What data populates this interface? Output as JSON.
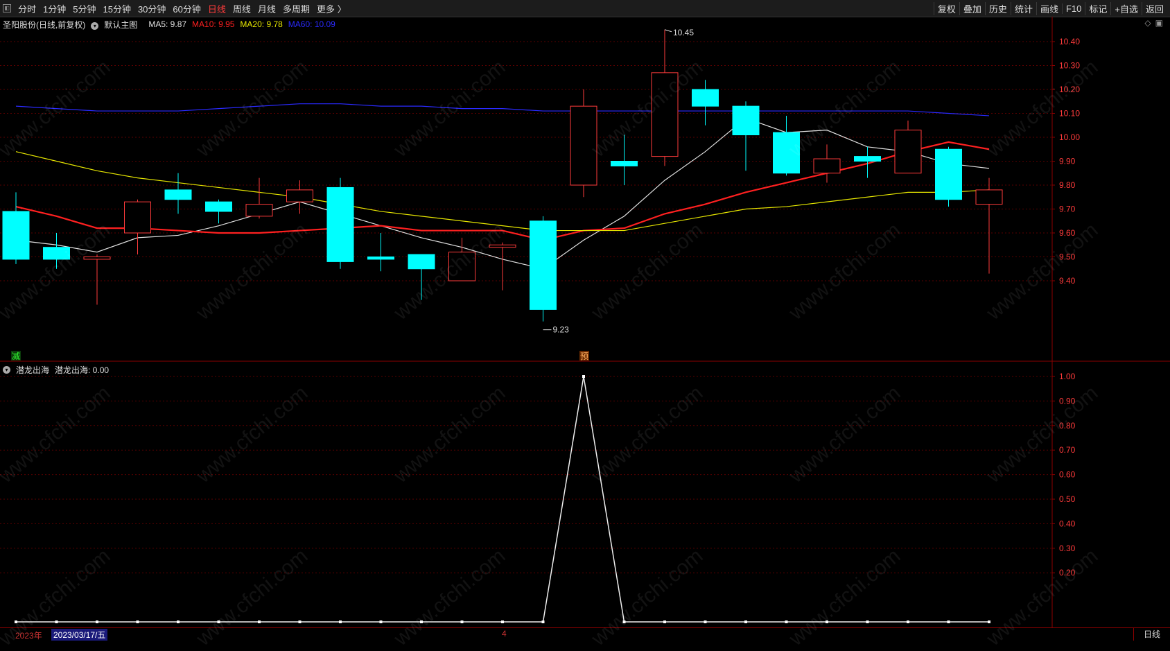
{
  "toolbar": {
    "tabs": [
      {
        "label": "分时",
        "active": false
      },
      {
        "label": "1分钟",
        "active": false
      },
      {
        "label": "5分钟",
        "active": false
      },
      {
        "label": "15分钟",
        "active": false
      },
      {
        "label": "30分钟",
        "active": false
      },
      {
        "label": "60分钟",
        "active": false
      },
      {
        "label": "日线",
        "active": true
      },
      {
        "label": "周线",
        "active": false
      },
      {
        "label": "月线",
        "active": false
      },
      {
        "label": "多周期",
        "active": false
      },
      {
        "label": "更多 〉",
        "active": false
      }
    ],
    "tools": [
      "复权",
      "叠加",
      "历史",
      "统计",
      "画线",
      "F10",
      "标记",
      "+自选",
      "返回"
    ]
  },
  "main_info": {
    "stock": "圣阳股份(日线,前复权)",
    "template": "默认主图",
    "ma5": "MA5: 9.87",
    "ma10": "MA10: 9.95",
    "ma20": "MA20: 9.78",
    "ma60": "MA60: 10.09"
  },
  "indicator_info": {
    "name": "潜龙出海",
    "value_label": "潜龙出海: 0.00"
  },
  "markers": {
    "high_label": "10.45",
    "low_label": "9.23",
    "reduce_tag": "减",
    "pre_tag": "预"
  },
  "bottom": {
    "year": "2023年",
    "date": "2023/03/17/五",
    "month_mark": "4",
    "period": "日线"
  },
  "colors": {
    "up": "#ff3b3b",
    "down": "#00ffff",
    "ma5": "#e0e0e0",
    "ma10": "#ff2020",
    "ma20": "#e6e600",
    "ma60": "#2a2aff",
    "grid": "#5a0000",
    "axis_text": "#ff3b3b"
  },
  "chart_data": [
    {
      "type": "candlestick",
      "ylim": [
        9.2,
        10.5
      ],
      "yticks": [
        9.4,
        9.5,
        9.6,
        9.7,
        9.8,
        9.9,
        10.0,
        10.1,
        10.2,
        10.3,
        10.4
      ],
      "candles": [
        {
          "o": 9.69,
          "h": 9.77,
          "l": 9.47,
          "c": 9.49
        },
        {
          "o": 9.54,
          "h": 9.6,
          "l": 9.45,
          "c": 9.49
        },
        {
          "o": 9.49,
          "h": 9.51,
          "l": 9.3,
          "c": 9.5
        },
        {
          "o": 9.6,
          "h": 9.74,
          "l": 9.51,
          "c": 9.73
        },
        {
          "o": 9.78,
          "h": 9.85,
          "l": 9.68,
          "c": 9.74
        },
        {
          "o": 9.73,
          "h": 9.74,
          "l": 9.64,
          "c": 9.69
        },
        {
          "o": 9.67,
          "h": 9.83,
          "l": 9.66,
          "c": 9.72
        },
        {
          "o": 9.73,
          "h": 9.82,
          "l": 9.68,
          "c": 9.78
        },
        {
          "o": 9.79,
          "h": 9.83,
          "l": 9.45,
          "c": 9.48
        },
        {
          "o": 9.5,
          "h": 9.6,
          "l": 9.44,
          "c": 9.49
        },
        {
          "o": 9.51,
          "h": 9.51,
          "l": 9.32,
          "c": 9.45
        },
        {
          "o": 9.4,
          "h": 9.58,
          "l": 9.4,
          "c": 9.52
        },
        {
          "o": 9.54,
          "h": 9.56,
          "l": 9.36,
          "c": 9.55
        },
        {
          "o": 9.65,
          "h": 9.67,
          "l": 9.23,
          "c": 9.28
        },
        {
          "o": 9.8,
          "h": 10.2,
          "l": 9.75,
          "c": 10.13
        },
        {
          "o": 9.9,
          "h": 10.01,
          "l": 9.8,
          "c": 9.88
        },
        {
          "o": 9.92,
          "h": 10.45,
          "l": 9.88,
          "c": 10.27
        },
        {
          "o": 10.2,
          "h": 10.24,
          "l": 10.05,
          "c": 10.13
        },
        {
          "o": 10.13,
          "h": 10.15,
          "l": 9.86,
          "c": 10.01
        },
        {
          "o": 10.02,
          "h": 10.09,
          "l": 9.84,
          "c": 9.85
        },
        {
          "o": 9.85,
          "h": 9.97,
          "l": 9.81,
          "c": 9.91
        },
        {
          "o": 9.92,
          "h": 9.96,
          "l": 9.83,
          "c": 9.9
        },
        {
          "o": 9.85,
          "h": 10.07,
          "l": 9.85,
          "c": 10.03
        },
        {
          "o": 9.95,
          "h": 9.96,
          "l": 9.71,
          "c": 9.74
        },
        {
          "o": 9.72,
          "h": 9.83,
          "l": 9.43,
          "c": 9.78
        }
      ],
      "series": [
        {
          "name": "MA5",
          "values": [
            9.57,
            9.55,
            9.52,
            9.58,
            9.59,
            9.63,
            9.68,
            9.73,
            9.68,
            9.63,
            9.58,
            9.54,
            9.49,
            9.45,
            9.57,
            9.67,
            9.82,
            9.94,
            10.08,
            10.02,
            10.03,
            9.96,
            9.94,
            9.89,
            9.87
          ]
        },
        {
          "name": "MA10",
          "values": [
            9.71,
            9.67,
            9.62,
            9.62,
            9.61,
            9.6,
            9.6,
            9.61,
            9.62,
            9.63,
            9.61,
            9.61,
            9.61,
            9.57,
            9.61,
            9.62,
            9.68,
            9.72,
            9.77,
            9.81,
            9.85,
            9.89,
            9.94,
            9.98,
            9.95
          ]
        },
        {
          "name": "MA20",
          "values": [
            9.94,
            9.9,
            9.86,
            9.83,
            9.81,
            9.79,
            9.77,
            9.75,
            9.72,
            9.69,
            9.67,
            9.65,
            9.63,
            9.61,
            9.61,
            9.61,
            9.64,
            9.67,
            9.7,
            9.71,
            9.73,
            9.75,
            9.77,
            9.77,
            9.78
          ]
        },
        {
          "name": "MA60",
          "values": [
            10.13,
            10.12,
            10.11,
            10.11,
            10.11,
            10.12,
            10.13,
            10.14,
            10.14,
            10.13,
            10.13,
            10.12,
            10.12,
            10.11,
            10.11,
            10.11,
            10.11,
            10.11,
            10.11,
            10.11,
            10.11,
            10.11,
            10.11,
            10.1,
            10.09
          ]
        }
      ]
    },
    {
      "type": "line",
      "ylim": [
        0.0,
        1.04
      ],
      "yticks": [
        0.2,
        0.3,
        0.4,
        0.5,
        0.6,
        0.7,
        0.8,
        0.9,
        1.0
      ],
      "series": [
        {
          "name": "潜龙出海",
          "values": [
            0,
            0,
            0,
            0,
            0,
            0,
            0,
            0,
            0,
            0,
            0,
            0,
            0,
            0,
            1,
            0,
            0,
            0,
            0,
            0,
            0,
            0,
            0,
            0,
            0
          ]
        }
      ]
    }
  ]
}
